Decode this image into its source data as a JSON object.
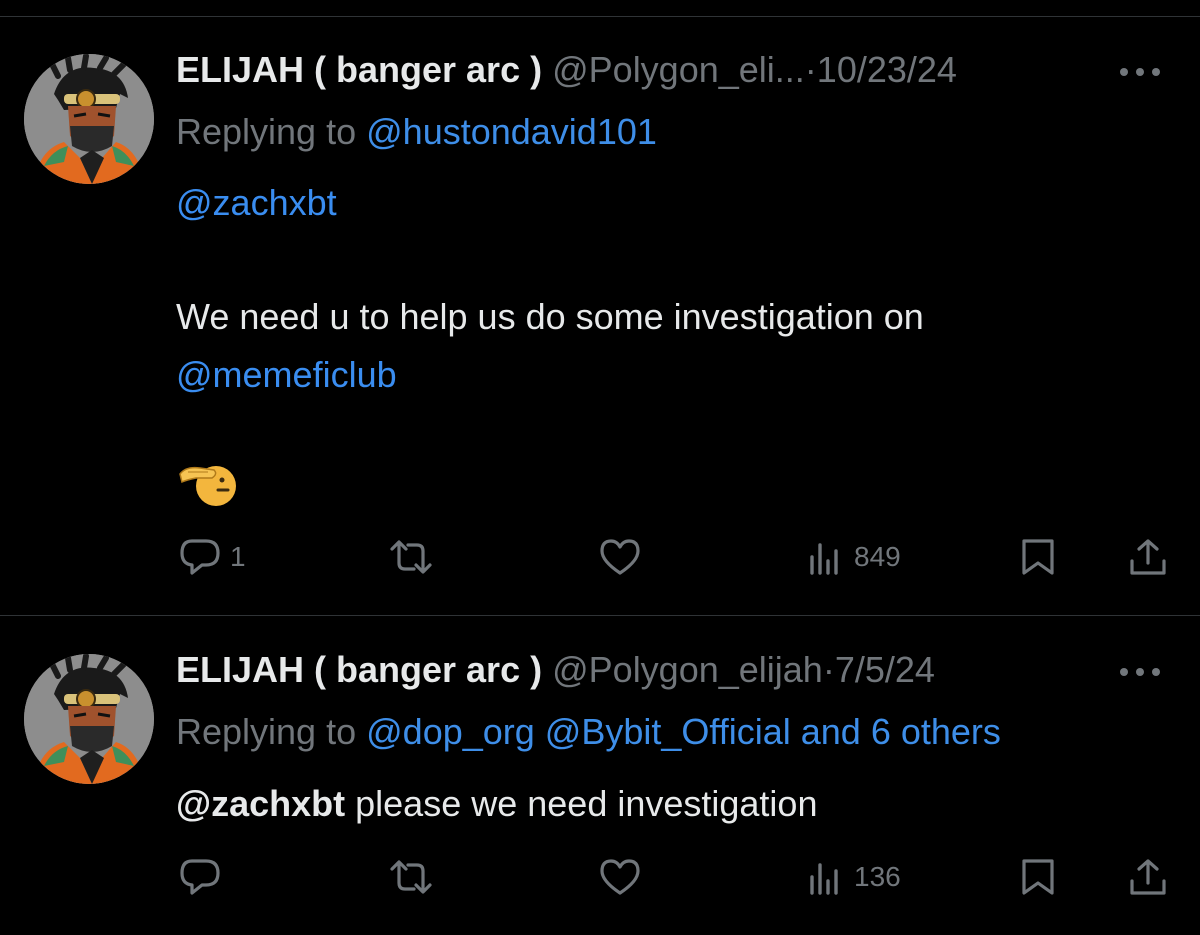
{
  "tweets": [
    {
      "name": "ELIJAH ( banger arc )",
      "handle": "@Polygon_eli...",
      "separator": "·",
      "date": "10/23/24",
      "replying_prefix": "Replying to",
      "replying_to": "@hustondavid101",
      "line1_mention": "@zachxbt",
      "line2": "We need u to help us do some investigation on",
      "line3_mention": "@memeficlub",
      "emoji": "saluting-hand-emoji",
      "actions": {
        "reply_count": "1",
        "retweet_count": "",
        "like_count": "",
        "views_count": "849"
      }
    },
    {
      "name": "ELIJAH ( banger arc )",
      "handle": "@Polygon_elijah",
      "separator": "·",
      "date": "7/5/24",
      "replying_prefix": "Replying to",
      "replying_to": "@dop_org @Bybit_Official and 6 others",
      "mention": "@zachxbt",
      "text": " please we need investigation",
      "actions": {
        "reply_count": "",
        "retweet_count": "",
        "like_count": "",
        "views_count": "136"
      }
    }
  ],
  "icons": {
    "reply": "reply-icon",
    "retweet": "retweet-icon",
    "like": "heart-icon",
    "views": "views-chart-icon",
    "bookmark": "bookmark-icon",
    "share": "share-icon",
    "more": "more-dots-icon"
  },
  "colors": {
    "background": "#000000",
    "text": "#e7e9ea",
    "muted": "#71767b",
    "link": "#1d9bf0",
    "divider": "#2f3336"
  }
}
